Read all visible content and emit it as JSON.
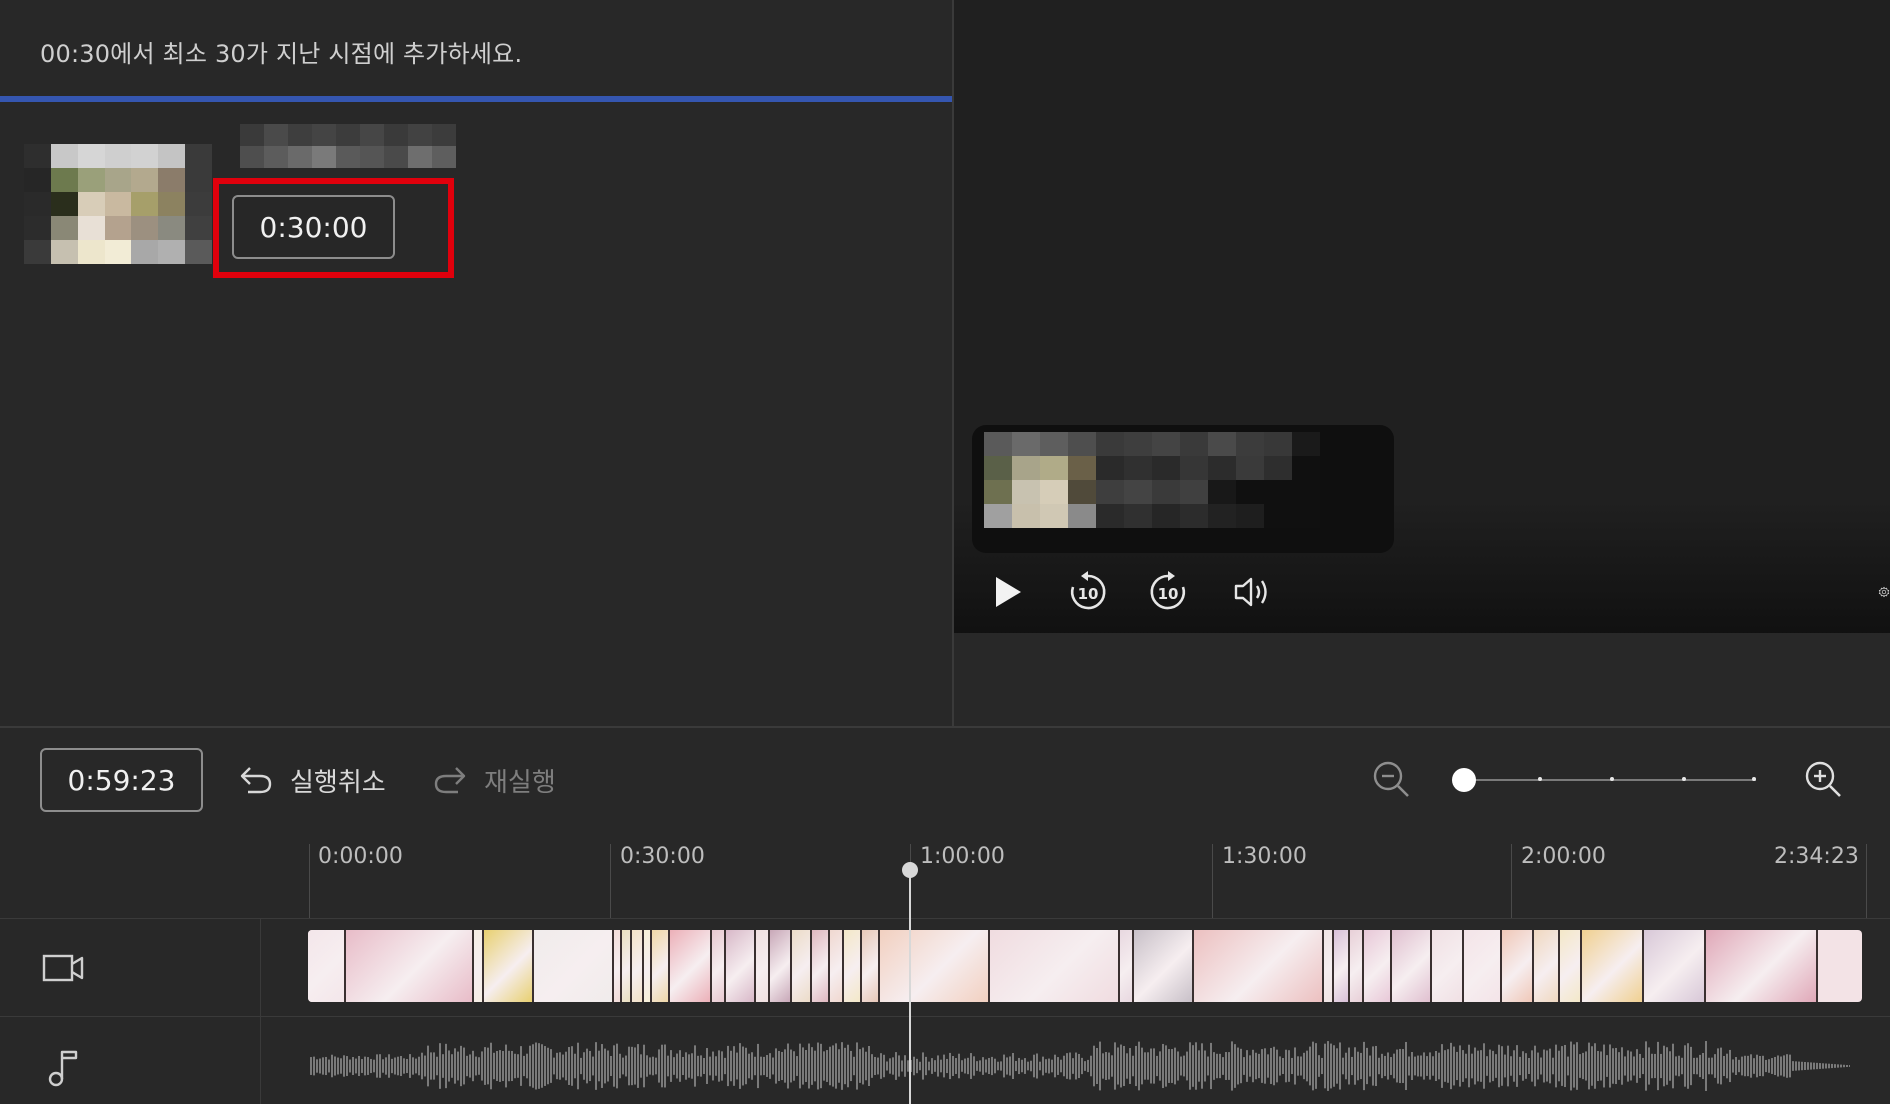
{
  "instruction": {
    "text": "00:30에서 최소 30가 지난 시점에 추가하세요.",
    "progress_fraction": 1.0,
    "progress_color": "#3556b0"
  },
  "chapter": {
    "time_value": "0:30:00",
    "highlight_color": "#e0000c"
  },
  "player": {
    "icons": [
      "play-icon",
      "rewind-10-icon",
      "forward-10-icon",
      "volume-icon",
      "settings-icon"
    ],
    "rewind_seconds": "10",
    "forward_seconds": "10"
  },
  "toolbar": {
    "current_time": "0:59:23",
    "undo_label": "실행취소",
    "redo_label": "재실행",
    "zoom_level": 0
  },
  "timeline": {
    "ticks": [
      "0:00:00",
      "0:30:00",
      "1:00:00",
      "1:30:00",
      "2:00:00",
      "2:34:23"
    ],
    "playhead": "0:59:23"
  }
}
